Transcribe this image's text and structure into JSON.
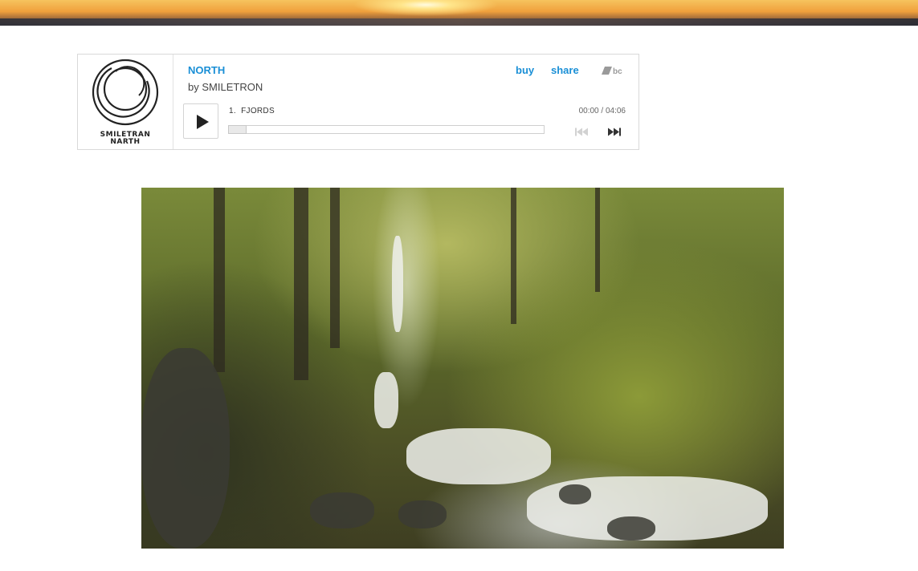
{
  "player": {
    "album_title": "NORTH",
    "by_prefix": "by",
    "artist": "SMILETRON",
    "buy_label": "buy",
    "share_label": "share",
    "brand_logo": "bc",
    "art_text_line1": "SMILETRAN",
    "art_text_line2": "NARTH",
    "track_number": "1.",
    "track_title": "FJORDS",
    "time_current": "00:00",
    "time_separator": "/",
    "time_total": "04:06",
    "progress_fraction": 0,
    "accent_color": "#1a8fd6",
    "icons": [
      "play-icon",
      "previous-track-icon",
      "next-track-icon",
      "bandcamp-logo"
    ]
  },
  "media": {
    "banner": "sunset-banner-image",
    "video": "forest-waterfall-video"
  }
}
